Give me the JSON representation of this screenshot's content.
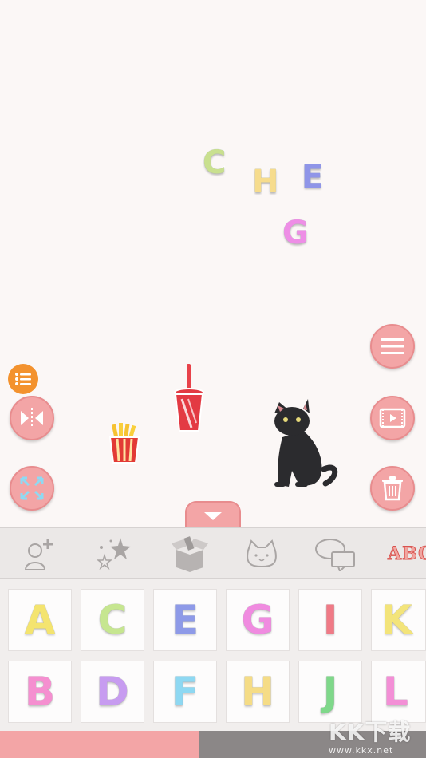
{
  "canvas": {
    "letters": [
      {
        "char": "C",
        "color": "#c9e08f"
      },
      {
        "char": "H",
        "color": "#f6dc8d"
      },
      {
        "char": "E",
        "color": "#8f95e8"
      },
      {
        "char": "G",
        "color": "#ee8ee6"
      }
    ],
    "stickers": [
      "soda-cup",
      "french-fries",
      "black-cat"
    ]
  },
  "side_buttons": {
    "left": [
      "list-icon",
      "flip-horizontal-icon",
      "expand-icon"
    ],
    "right": [
      "menu-icon",
      "preview-play-icon",
      "trash-icon"
    ]
  },
  "category_bar": {
    "items": [
      "avatar-add-icon",
      "stars-icon",
      "box-items-icon",
      "cat-face-icon",
      "chat-bubbles-icon"
    ],
    "abc_label": "ABC"
  },
  "letter_grid": {
    "row1": [
      {
        "char": "A",
        "color": "#f4e46f"
      },
      {
        "char": "C",
        "color": "#c6e690"
      },
      {
        "char": "E",
        "color": "#8e9ae8"
      },
      {
        "char": "G",
        "color": "#f08be0"
      },
      {
        "char": "I",
        "color": "#f07a86"
      },
      {
        "char": "K",
        "color": "#f3e47a"
      }
    ],
    "row2": [
      {
        "char": "B",
        "color": "#f58fd0"
      },
      {
        "char": "D",
        "color": "#c79cf0"
      },
      {
        "char": "F",
        "color": "#8ed8f2"
      },
      {
        "char": "H",
        "color": "#f5dc86"
      },
      {
        "char": "J",
        "color": "#7fd88a"
      },
      {
        "char": "L",
        "color": "#f38fd6"
      }
    ]
  },
  "watermark": {
    "big": "KK下载",
    "small": "www.kkx.net"
  }
}
